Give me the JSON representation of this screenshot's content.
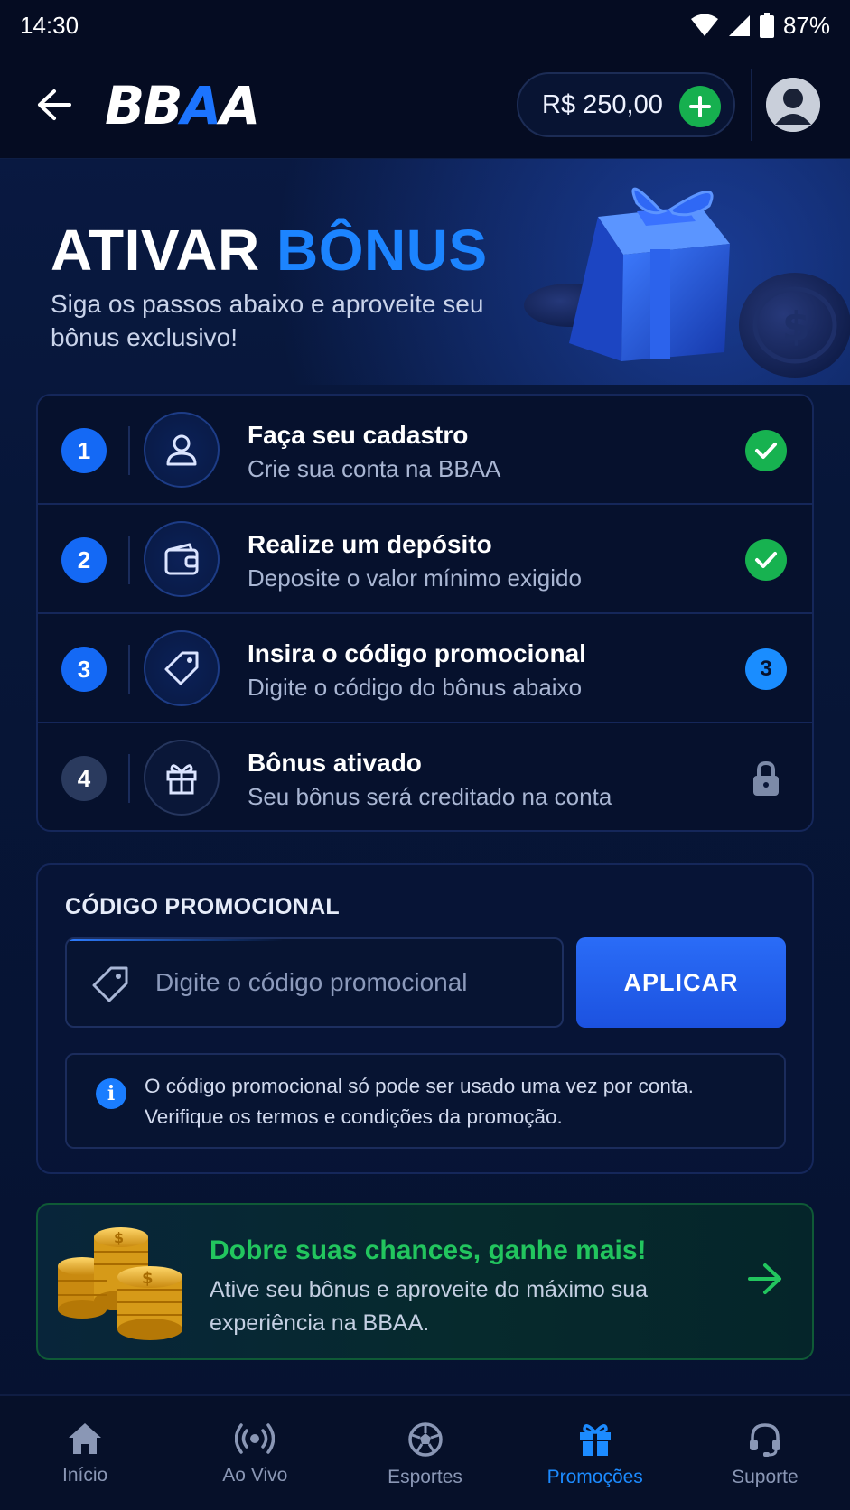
{
  "status_bar": {
    "time": "14:30",
    "battery": "87%"
  },
  "header": {
    "logo_part1": "BB",
    "logo_part2": "A",
    "logo_part3": "A",
    "balance": "R$ 250,00"
  },
  "hero": {
    "title_main": "ATIVAR",
    "title_accent": "BÔNUS",
    "subtitle": "Siga os passos abaixo e aproveite seu bônus exclusivo!"
  },
  "steps": [
    {
      "number": "1",
      "title": "Faça seu cadastro",
      "description": "Crie sua conta na BBAA",
      "status": "done",
      "icon": "user-icon"
    },
    {
      "number": "2",
      "title": "Realize um depósito",
      "description": "Deposite o valor mínimo exigido",
      "status": "done",
      "icon": "wallet-icon"
    },
    {
      "number": "3",
      "title": "Insira o código promocional",
      "description": "Digite o código do bônus abaixo",
      "status": "current",
      "status_label": "3",
      "icon": "tag-icon"
    },
    {
      "number": "4",
      "title": "Bônus ativado",
      "description": "Seu bônus será creditado na conta",
      "status": "locked",
      "icon": "gift-icon"
    }
  ],
  "promo": {
    "label": "CÓDIGO PROMOCIONAL",
    "input_value": "",
    "input_placeholder": "Digite o código promocional",
    "apply_label": "APLICAR",
    "info_line1": "O código promocional só pode ser usado uma vez por conta.",
    "info_line2": "Verifique os termos e condições da promoção."
  },
  "banner": {
    "title": "Dobre suas chances, ganhe mais!",
    "text": "Ative seu bônus e aproveite do máximo sua experiência na BBAA."
  },
  "bottom_nav": [
    {
      "label": "Início",
      "icon": "home-icon",
      "active": false
    },
    {
      "label": "Ao Vivo",
      "icon": "live-broadcast-icon",
      "active": false
    },
    {
      "label": "Esportes",
      "icon": "soccer-ball-icon",
      "active": false
    },
    {
      "label": "Promoções",
      "icon": "gift-icon",
      "active": true
    },
    {
      "label": "Suporte",
      "icon": "headset-icon",
      "active": false
    }
  ],
  "colors": {
    "accent_blue": "#1c84ff",
    "success_green": "#17b250",
    "background": "#061330"
  }
}
